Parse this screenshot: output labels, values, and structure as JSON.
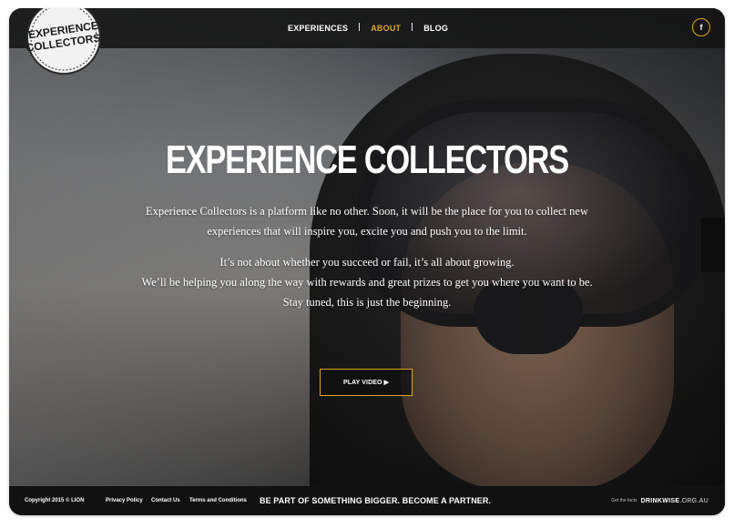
{
  "brand": {
    "logo_text_line1": "EXPERIENCE",
    "logo_text_line2": "COLLECTORS"
  },
  "nav": {
    "items": [
      {
        "label": "EXPERIENCES",
        "active": false
      },
      {
        "label": "ABOUT",
        "active": true
      },
      {
        "label": "BLOG",
        "active": false
      }
    ],
    "facebook_icon": "f"
  },
  "hero": {
    "title": "EXPERIENCE COLLECTORS",
    "paragraph1_line1": "Experience Collectors is a platform like no other. Soon, it will be the place for you to collect new",
    "paragraph1_line2": "experiences that will inspire you, excite you and push you to the limit.",
    "paragraph2_line1": "It’s not about whether you succeed or fail, it’s all about growing.",
    "paragraph2_line2": "We’ll be helping you along the way with rewards and great prizes to get you where you want to be.",
    "paragraph2_line3": "Stay tuned, this is just the beginning.",
    "play_label": "PLAY VIDEO",
    "play_icon": "▶"
  },
  "footer": {
    "copyright": "Copyright 2015 © LION",
    "links": [
      "Privacy Policy",
      "Contact Us",
      "Terms and Conditions"
    ],
    "tagline": "BE PART OF SOMETHING BIGGER. BECOME A PARTNER.",
    "facts_label": "Get the facts",
    "drinkwise_bold": "DRINKWISE",
    "drinkwise_light": ".ORG.AU"
  },
  "colors": {
    "accent": "#e3a51f",
    "topbar": "#141414",
    "footer": "#111111"
  }
}
